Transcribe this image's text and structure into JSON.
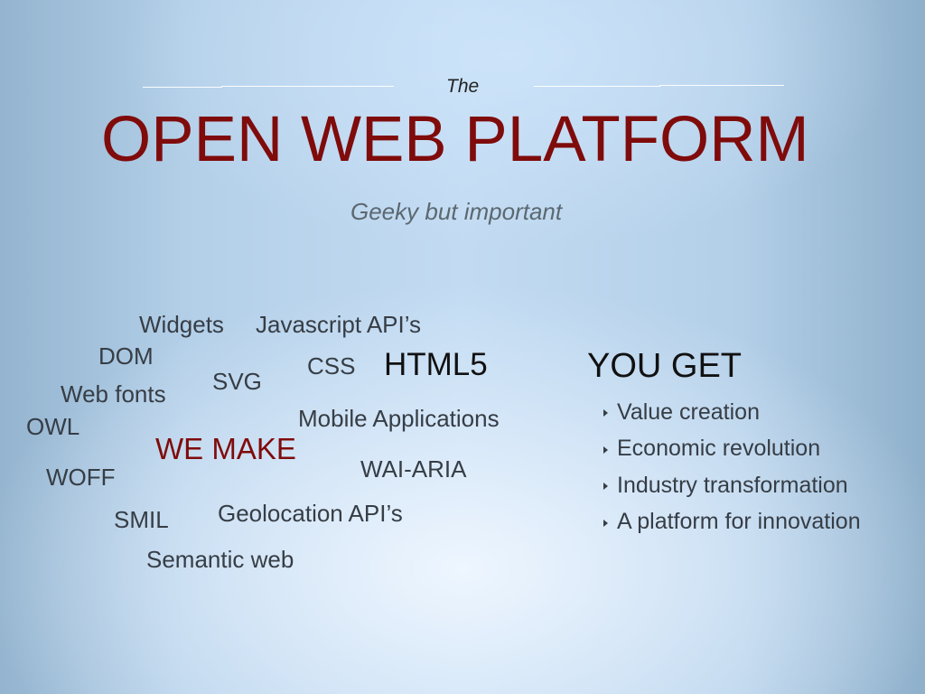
{
  "slide": {
    "kicker": "The",
    "title": "OPEN WEB PLATFORM",
    "subtitle": "Geeky but important",
    "word_cloud": {
      "heading": "WE MAKE",
      "words": [
        "Widgets",
        "Javascript API’s",
        "DOM",
        "CSS",
        "HTML5",
        "SVG",
        "Web fonts",
        "Mobile Applications",
        "OWL",
        "WAI-ARIA",
        "WOFF",
        "SMIL",
        "Geolocation API’s",
        "Semantic web"
      ]
    },
    "benefits": {
      "heading": "YOU GET",
      "bullet_icon": "triangle-right-icon",
      "items": [
        "Value creation",
        "Economic revolution",
        "Industry transformation",
        "A platform for innovation"
      ]
    },
    "colors": {
      "title": "#7f0b0b",
      "heading_red": "#7f0b0b",
      "body_text": "#363d45",
      "subtitle": "#5c6870"
    }
  }
}
